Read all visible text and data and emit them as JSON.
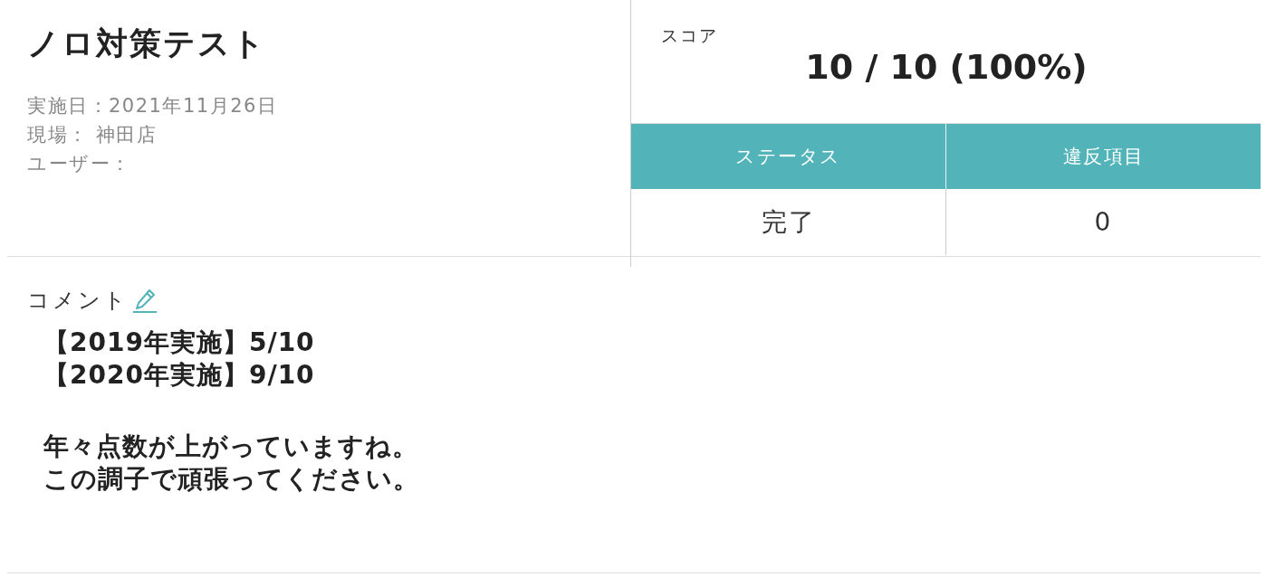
{
  "title": "ノロ対策テスト",
  "info": [
    "実施日：2021年11月26日",
    "現場： 神田店",
    "ユーザー："
  ],
  "score": {
    "label": "スコア",
    "value": "10 / 10 (100%)"
  },
  "summary_table": {
    "columns": [
      "ステータス",
      "違反項目"
    ],
    "rows": [
      [
        "完了",
        "0"
      ]
    ]
  },
  "comment": {
    "label": "コメント",
    "paragraphs": [
      [
        "【2019年実施】5/10",
        "【2020年実施】9/10"
      ],
      [
        "年々点数が上がっていますね。",
        "この調子で頑張ってください。"
      ]
    ]
  }
}
